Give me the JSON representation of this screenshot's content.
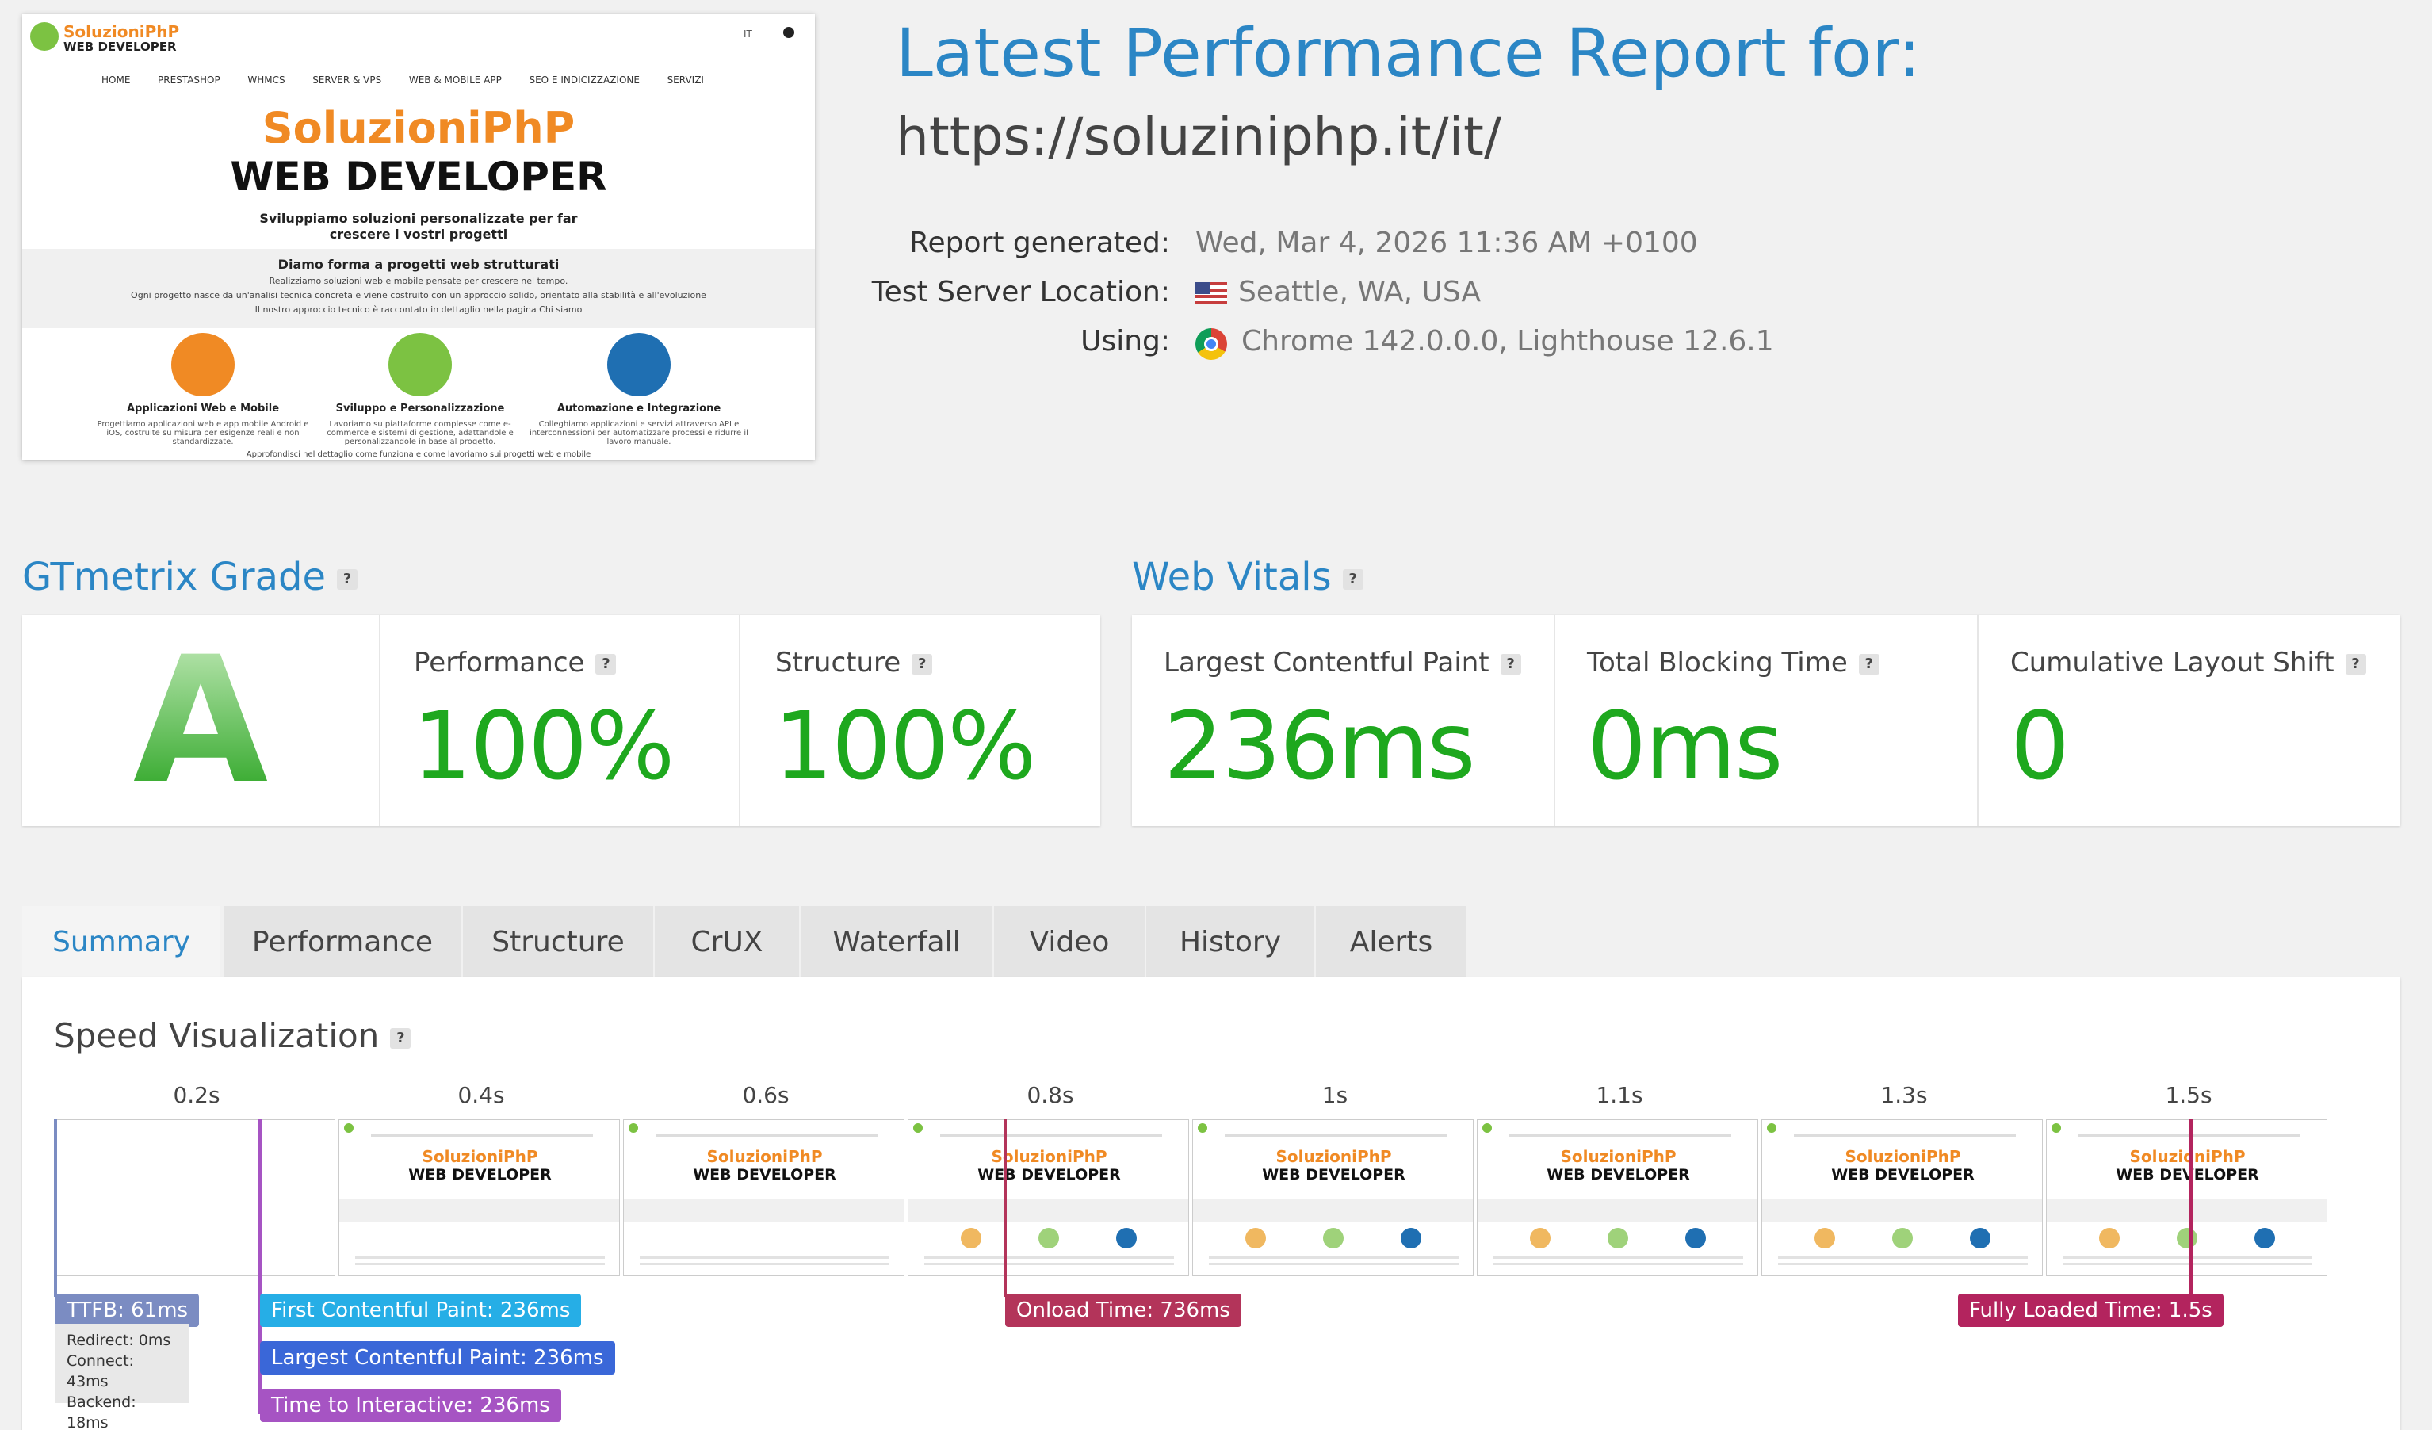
{
  "thumbnail": {
    "logo_line1": "SoluzioniPhP",
    "logo_line2": "WEB DEVELOPER",
    "lang": "IT",
    "nav": [
      "HOME",
      "PRESTASHOP",
      "WHMCS",
      "SERVER & VPS",
      "WEB & MOBILE APP",
      "SEO E INDICIZZAZIONE",
      "SERVIZI"
    ],
    "hero_title": "SoluzioniPhP",
    "hero_subtitle": "WEB DEVELOPER",
    "hero_tagline_1": "Sviluppiamo soluzioni personalizzate per far",
    "hero_tagline_2": "crescere i vostri progetti",
    "band_title": "Diamo forma a progetti web strutturati",
    "band_line1": "Realizziamo soluzioni web e mobile pensate per crescere nel tempo.",
    "band_line2": "Ogni progetto nasce da un'analisi tecnica concreta e viene costruito con un approccio solido, orientato alla stabilità e all'evoluzione",
    "band_line3": "Il nostro approccio tecnico è raccontato in dettaglio nella pagina Chi siamo",
    "features": [
      {
        "title": "Applicazioni Web e Mobile",
        "text": "Progettiamo applicazioni web e app mobile Android e iOS, costruite su misura per esigenze reali e non standardizzate."
      },
      {
        "title": "Sviluppo e Personalizzazione",
        "text": "Lavoriamo su piattaforme complesse come e-commerce e sistemi di gestione, adattandole e personalizzandole in base al progetto."
      },
      {
        "title": "Automazione e Integrazione",
        "text": "Colleghiamo applicazioni e servizi attraverso API e interconnessioni per automatizzare processi e ridurre il lavoro manuale."
      }
    ],
    "footer_cut": "Approfondisci nel dettaglio come funziona e come lavoriamo sui progetti web e mobile"
  },
  "report": {
    "title": "Latest Performance Report for:",
    "url": "https://soluziniphp.it/it/",
    "generated_label": "Report generated:",
    "generated_value": "Wed, Mar 4, 2026 11:36 AM +0100",
    "location_label": "Test Server Location:",
    "location_value": "Seattle, WA, USA",
    "using_label": "Using:",
    "using_value": "Chrome 142.0.0.0, Lighthouse 12.6.1"
  },
  "grade": {
    "heading": "GTmetrix Grade",
    "letter": "A",
    "performance_label": "Performance",
    "performance_value": "100%",
    "structure_label": "Structure",
    "structure_value": "100%",
    "help": "?"
  },
  "vitals": {
    "heading": "Web Vitals",
    "lcp_label": "Largest Contentful Paint",
    "lcp_value": "236ms",
    "tbt_label": "Total Blocking Time",
    "tbt_value": "0ms",
    "cls_label": "Cumulative Layout Shift",
    "cls_value": "0"
  },
  "tabs": [
    "Summary",
    "Performance",
    "Structure",
    "CrUX",
    "Waterfall",
    "Video",
    "History",
    "Alerts"
  ],
  "speed": {
    "heading": "Speed Visualization",
    "ticks": [
      "0.2s",
      "0.4s",
      "0.6s",
      "0.8s",
      "1s",
      "1.1s",
      "1.3s",
      "1.5s"
    ],
    "frame_title": "SoluzioniPhP",
    "frame_subtitle": "WEB DEVELOPER",
    "ttfb": "TTFB: 61ms",
    "redirect": "Redirect: 0ms",
    "connect": "Connect: 43ms",
    "backend": "Backend: 18ms",
    "fcp": "First Contentful Paint: 236ms",
    "lcp": "Largest Contentful Paint: 236ms",
    "tti": "Time to Interactive: 236ms",
    "onload": "Onload Time: 736ms",
    "fully_loaded": "Fully Loaded Time: 1.5s"
  },
  "colors": {
    "blue": "#2b86c5",
    "green": "#1ea81e",
    "ttfb": "#7b8cc2",
    "fcp": "#26aee6",
    "lcp": "#3a67d8",
    "tti": "#a654c3",
    "onload": "#b3345a",
    "fully": "#b3245e"
  }
}
